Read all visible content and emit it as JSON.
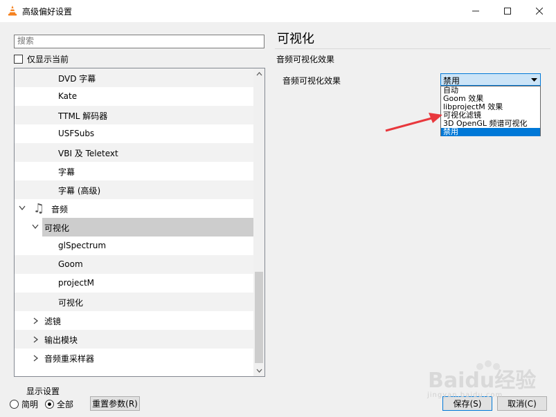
{
  "window": {
    "title": "高级偏好设置"
  },
  "search": {
    "placeholder": "搜索"
  },
  "show_current": {
    "label": "仅显示当前"
  },
  "tree": {
    "items": [
      {
        "label": "DVD 字幕"
      },
      {
        "label": "Kate"
      },
      {
        "label": "TTML 解码器"
      },
      {
        "label": "USFSubs"
      },
      {
        "label": "VBI 及 Teletext"
      },
      {
        "label": "字幕"
      },
      {
        "label": "字幕 (高级)"
      },
      {
        "label": "音频"
      },
      {
        "label": "可视化"
      },
      {
        "label": "glSpectrum"
      },
      {
        "label": "Goom"
      },
      {
        "label": "projectM"
      },
      {
        "label": "可视化"
      },
      {
        "label": "滤镜"
      },
      {
        "label": "输出模块"
      },
      {
        "label": "音频重采样器"
      }
    ]
  },
  "display_settings": {
    "label": "显示设置",
    "simple": "简明",
    "all": "全部",
    "selected": "all"
  },
  "buttons": {
    "reset": "重置参数(R)",
    "save": "保存(S)",
    "cancel": "取消(C)"
  },
  "panel": {
    "title": "可视化",
    "subtitle": "音频可视化效果",
    "option_label": "音频可视化效果",
    "selected_value": "禁用",
    "options": [
      "自动",
      "Goom 效果",
      "libprojectM 效果",
      "可视化滤镜",
      "3D OpenGL 频谱可视化",
      "禁用"
    ],
    "highlighted_index": 5
  },
  "watermark": {
    "text": "Baidu经验",
    "sub": "jingyan.baidu.com"
  },
  "colors": {
    "accent": "#0078d7",
    "annotation_arrow": "#e8383d",
    "selection": "#cdcdcd"
  },
  "icons": {
    "app": "vlc-cone-icon",
    "minimize": "minimize-icon",
    "maximize": "maximize-icon",
    "close": "close-icon",
    "music": "music-note-icon"
  }
}
